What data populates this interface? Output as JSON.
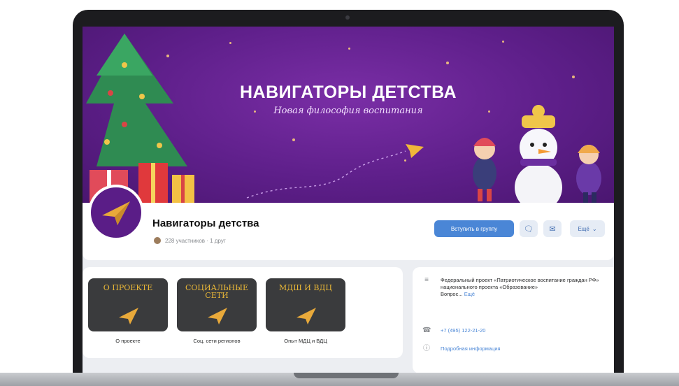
{
  "cover": {
    "title": "НАВИГАТОРЫ ДЕТСТВА",
    "subtitle": "Новая философия воспитания"
  },
  "group": {
    "name": "Навигаторы детства",
    "meta": "228 участников · 1 друг"
  },
  "actions": {
    "join_label": "Вступить в группу",
    "message_icon": "chat-bubble-icon",
    "mail_icon": "envelope-icon",
    "more_label": "Ещё"
  },
  "tiles": [
    {
      "title": "О проекте",
      "label": "О проекте"
    },
    {
      "title": "Социальные сети",
      "label": "Соц. сети регионов"
    },
    {
      "title": "МДШ и ВДЦ",
      "label": "Опыт МДЦ и ВДЦ"
    }
  ],
  "info": {
    "description": "Федеральный проект «Патриотическое воспитание граждан РФ» национального проекта «Образование»",
    "description_tail": "Вопрос...",
    "more_link": "Ещё",
    "phone": "+7 (495) 122-21-20",
    "details_link": "Подробная информация"
  },
  "colors": {
    "cover": "#5e1f8a",
    "accent": "#4a86d6",
    "tile": "#3a3b3d",
    "tile_text": "#e9b737",
    "plane": "#e8a93a"
  }
}
